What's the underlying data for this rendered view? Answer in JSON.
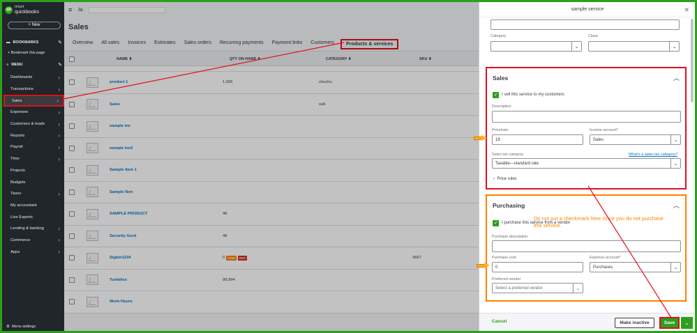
{
  "sidebar": {
    "logo_top": "intuit",
    "logo_bottom": "quickbooks",
    "new_label": "+ New",
    "bookmarks_label": "BOOKMARKS",
    "bookmark_item": "Bookmark this page",
    "menu_label": "MENU",
    "items": [
      {
        "label": "Dashboards"
      },
      {
        "label": "Transactions"
      },
      {
        "label": "Sales"
      },
      {
        "label": "Expenses"
      },
      {
        "label": "Customers & leads"
      },
      {
        "label": "Reports"
      },
      {
        "label": "Payroll"
      },
      {
        "label": "Time"
      },
      {
        "label": "Projects"
      },
      {
        "label": "Budgets"
      },
      {
        "label": "Taxes"
      },
      {
        "label": "My accountant"
      },
      {
        "label": "Live Experts"
      },
      {
        "label": "Lending & banking"
      },
      {
        "label": "Commerce"
      },
      {
        "label": "Apps"
      }
    ],
    "menu_settings": "Menu settings"
  },
  "topbar": {
    "company_initial": "Ja"
  },
  "page": {
    "title": "Sales",
    "tabs": [
      "Overview",
      "All sales",
      "Invoices",
      "Estimates",
      "Sales orders",
      "Recurring payments",
      "Payment links",
      "Customers",
      "Products & services"
    ]
  },
  "table": {
    "headers": {
      "name": "NAME ⬍",
      "qty": "QTY ON HAND ⬍",
      "category": "CATEGORY ⬍",
      "sku": "SKU ⬍"
    },
    "rows": [
      {
        "name": "product 1",
        "qty": "1,006",
        "category": "chuchu",
        "sku": ""
      },
      {
        "name": "Sales",
        "qty": "",
        "category": "sub",
        "sku": ""
      },
      {
        "name": "sample inv",
        "qty": "",
        "category": "",
        "sku": ""
      },
      {
        "name": "sample inv2",
        "qty": "",
        "category": "",
        "sku": ""
      },
      {
        "name": "Sample Item 1",
        "qty": "",
        "category": "",
        "sku": ""
      },
      {
        "name": "Sample Non",
        "qty": "",
        "category": "",
        "sku": ""
      },
      {
        "name": "SAMPLE PRODUCT",
        "qty": "48",
        "category": "",
        "sku": ""
      },
      {
        "name": "Security Gord",
        "qty": "48",
        "category": "",
        "sku": ""
      },
      {
        "name": "Sigbin1234",
        "qty": "0",
        "category": "",
        "sku": "4567",
        "badges": [
          "LOW",
          "OUT"
        ]
      },
      {
        "name": "Tumbliss",
        "qty": "99,994",
        "category": "",
        "sku": ""
      },
      {
        "name": "Work Hours",
        "qty": "",
        "category": "",
        "sku": ""
      }
    ]
  },
  "panel": {
    "title": "sample service",
    "category_label": "Category",
    "class_label": "Class",
    "sales": {
      "title": "Sales",
      "sell_checkbox": "I sell this service to my customers",
      "description_label": "Description",
      "price_label": "Price/rate",
      "price_value": "18",
      "income_label": "Income account*",
      "income_value": "Sales",
      "tax_label": "Sales tax category",
      "tax_link": "What's a sales tax category?",
      "tax_value": "Taxable—standard rate",
      "price_rules": "Price rules"
    },
    "purchasing": {
      "title": "Purchasing",
      "purchase_checkbox": "I purchase this service from a vendor",
      "description_label": "Purchase description",
      "cost_label": "Purchase cost",
      "cost_value": "0",
      "expense_label": "Expense account*",
      "expense_value": "Purchases",
      "vendor_label": "Preferred vendor",
      "vendor_placeholder": "Select a preferred vendor"
    },
    "annotation": "Do not put a checkmark here since you do not purchase this service.",
    "footer": {
      "cancel": "Cancel",
      "inactive": "Make inactive",
      "save": "Save"
    }
  },
  "colors": {
    "brand": "#2ca01c",
    "highlight_red": "#e0101b",
    "highlight_orange": "#ff8000",
    "link": "#0077c5"
  }
}
